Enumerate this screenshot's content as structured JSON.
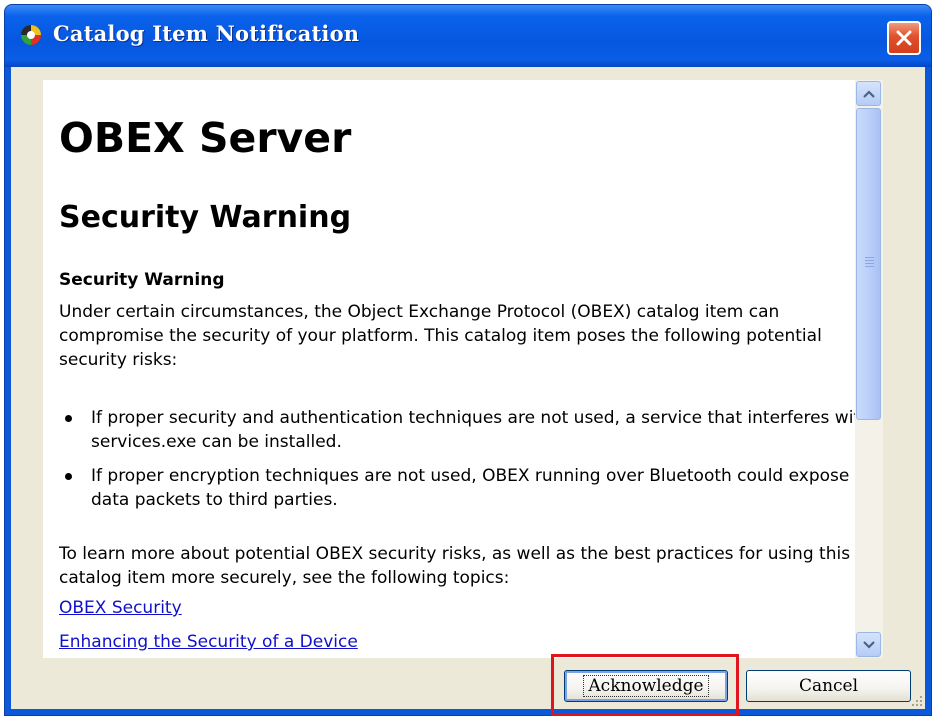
{
  "window": {
    "title": "Catalog Item Notification",
    "icon": "catalog-item-icon",
    "close_icon": "close-icon"
  },
  "document": {
    "heading1": "OBEX Server",
    "heading2": "Security Warning",
    "heading3": "Security Warning",
    "intro": "Under certain circumstances, the Object Exchange Protocol (OBEX) catalog item can compromise the security of your platform. This catalog item poses the following potential security risks:",
    "bullets": [
      "If proper security and authentication techniques are not used, a service that interferes with services.exe can be installed.",
      "If proper encryption techniques are not used, OBEX running over Bluetooth could expose data packets to third parties."
    ],
    "learn_more": "To learn more about potential OBEX security risks, as well as the best practices for using this catalog item more securely, see the following topics:",
    "links": [
      "OBEX Security",
      "Enhancing the Security of a Device"
    ]
  },
  "buttons": {
    "acknowledge": "Acknowledge",
    "cancel": "Cancel"
  },
  "colors": {
    "titlebar": "#0657e0",
    "link": "#1010cc",
    "highlight": "#e0141e",
    "dialog_face": "#ece9d8"
  }
}
